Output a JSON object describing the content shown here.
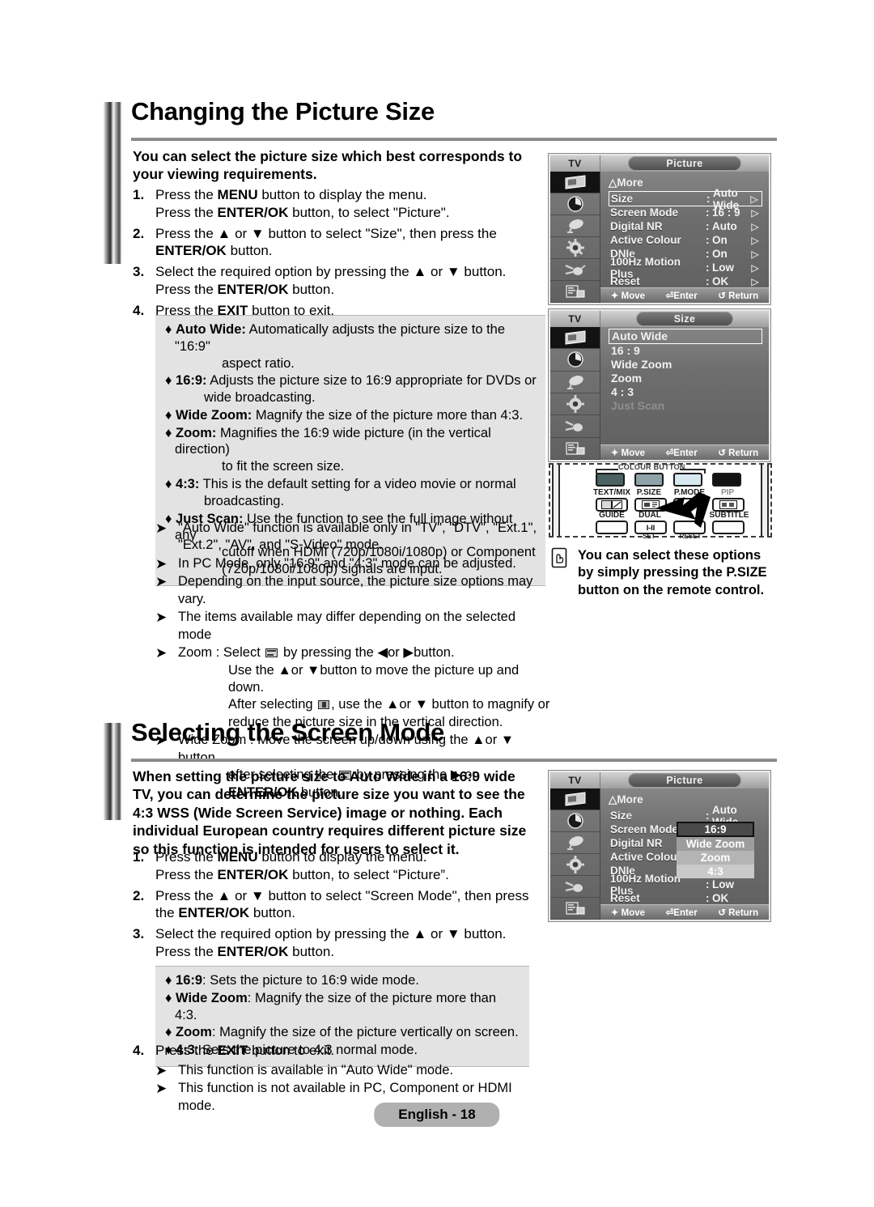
{
  "section1": {
    "title": "Changing the Picture Size",
    "intro": "You can select the picture size which best corresponds to your viewing requirements.",
    "steps": [
      {
        "num": "1.",
        "line1_a": "Press the ",
        "line1_b": "MENU",
        "line1_c": " button to display the menu.",
        "line2_a": "Press the ",
        "line2_b": "ENTER/OK",
        "line2_c": " button, to select \"Picture\"."
      },
      {
        "num": "2.",
        "line1_a": "Press the ▲ or ▼ button to select \"Size\", then press the ",
        "line1_b": "ENTER/OK",
        "line1_c": " button."
      },
      {
        "num": "3.",
        "line1_a": "Select the required option by pressing the ▲ or ▼ button.",
        "line2_a": "Press the ",
        "line2_b": "ENTER/OK",
        "line2_c": " button."
      },
      {
        "num": "4.",
        "line1_a": "Press the ",
        "line1_b": "EXIT",
        "line1_c": " button to exit."
      }
    ],
    "options": [
      {
        "label": "Auto Wide:",
        "text": " Automatically adjusts the picture size to the \"16:9\"",
        "cont": "aspect ratio."
      },
      {
        "label": "16:9:",
        "text": " Adjusts the picture size to 16:9 appropriate for DVDs or",
        "cont2": "wide broadcasting."
      },
      {
        "label": "Wide Zoom:",
        "text": " Magnify the size of the picture more than 4:3."
      },
      {
        "label": "Zoom:",
        "text": " Magnifies the 16:9 wide picture (in the vertical direction)",
        "cont": "to fit the screen size."
      },
      {
        "label": "4:3:",
        "text": " This is the default setting for a video movie or normal",
        "cont2": "broadcasting."
      },
      {
        "label": "Just Scan:",
        "text": " Use the function to see the full image without any",
        "cont": "cutoff when HDMI (720p/1080i/1080p) or Component",
        "cont_b": "(720p/1080i/1080p) signals are input."
      }
    ],
    "notes": [
      {
        "line1": "\"Auto Wide\" function is available only in \"TV\", \"DTV\",  \"Ext.1\",",
        "line2": "\"Ext.2\", \"AV\", and \"S-Video\" mode."
      },
      {
        "line1": "In PC Mode, only \"16:9\" and \"4:3\" mode can be adjusted."
      },
      {
        "line1": "Depending on the input source, the picture size options may vary."
      },
      {
        "line1": "The items available may differ depending on the selected mode"
      },
      {
        "line1_pre": "Zoom : Select ",
        "line1_post": " by pressing the ◀or ▶button.",
        "ind1": "Use the ▲or ▼button to move the picture up and down.",
        "ind2_pre": "After selecting ",
        "ind2_post": ", use the ▲or ▼ button to magnify or",
        "ind3": "reduce the picture size in the vertical direction."
      },
      {
        "line1": "Wide Zoom : Move the screen up/down using the ▲or ▼ button",
        "ind1_pre": "after selecting the ",
        "ind1_post": " by pressing the ▶ or",
        "ind2_bold": "ENTER/OK",
        "ind2_post": " button."
      }
    ]
  },
  "section2": {
    "title": "Selecting the Screen Mode",
    "intro": "When setting the picture size to Auto Wide in a 16:9 wide TV, you can determine the picture size you want to see the 4:3 WSS (Wide Screen Service) image or nothing. Each individual European country requires different picture size so this function is intended for users to select it.",
    "steps": [
      {
        "num": "1.",
        "line1_a": "Press the ",
        "line1_b": "MENU",
        "line1_c": " button to display the menu.",
        "line2_a": "Press the ",
        "line2_b": "ENTER/OK",
        "line2_c": " button, to select “Picture”."
      },
      {
        "num": "2.",
        "line1_a": "Press the ▲ or ▼ button to select \"Screen Mode\", then press",
        "line2_a": "the ",
        "line2_b": "ENTER/OK",
        "line2_c": " button."
      },
      {
        "num": "3.",
        "line1_a": "Select the required option by pressing the ▲ or ▼ button.",
        "line2_a": "Press the ",
        "line2_b": "ENTER/OK",
        "line2_c": " button."
      }
    ],
    "options": [
      {
        "label": "16:9",
        "text": ": Sets the picture to 16:9 wide mode."
      },
      {
        "label": "Wide Zoom",
        "text": ": Magnify the size of the picture more than 4:3."
      },
      {
        "label": "Zoom",
        "text": ": Magnify the size of the picture vertically on screen."
      },
      {
        "label": "4:3",
        "text": ": Sets the picture to 4:3 normal mode."
      }
    ],
    "step4": {
      "num": "4.",
      "line1_a": "Press the ",
      "line1_b": "EXIT",
      "line1_c": " button to exit."
    },
    "notes": [
      {
        "line1": "This function is available in \"Auto Wide\" mode."
      },
      {
        "line1": "This function is not available in PC, Component or HDMI mode."
      }
    ]
  },
  "osd_picture_top": {
    "source": "TV",
    "title": "Picture",
    "more": "More",
    "rows": [
      {
        "label": "Size",
        "value": "Auto Wide",
        "highlight": true
      },
      {
        "label": "Screen Mode",
        "value": "16 : 9"
      },
      {
        "label": "Digital NR",
        "value": "Auto"
      },
      {
        "label": "Active Colour",
        "value": "On"
      },
      {
        "label": "DNIe",
        "value": "On"
      },
      {
        "label": "100Hz Motion Plus",
        "value": "Low"
      },
      {
        "label": "Reset",
        "value": "OK"
      }
    ],
    "footer": {
      "move": "Move",
      "enter": "Enter",
      "return": "Return"
    }
  },
  "osd_size": {
    "source": "TV",
    "title": "Size",
    "items": [
      {
        "label": "Auto Wide",
        "highlight": true
      },
      {
        "label": "16 : 9"
      },
      {
        "label": "Wide Zoom"
      },
      {
        "label": "Zoom"
      },
      {
        "label": "4 : 3"
      },
      {
        "label": "Just Scan",
        "dim": true
      }
    ],
    "footer": {
      "move": "Move",
      "enter": "Enter",
      "return": "Return"
    }
  },
  "osd_picture_bottom": {
    "source": "TV",
    "title": "Picture",
    "more": "More",
    "rows": [
      {
        "label": "Size",
        "value": "Auto Wide"
      },
      {
        "label": "Screen Mode",
        "value": ""
      },
      {
        "label": "Digital NR",
        "value": ""
      },
      {
        "label": "Active Colour",
        "value": ""
      },
      {
        "label": "DNIe",
        "value": ""
      },
      {
        "label": "100Hz Motion Plus",
        "value": "Low"
      },
      {
        "label": "Reset",
        "value": "OK"
      }
    ],
    "dropdown": {
      "current": "16:9",
      "options": [
        "Wide Zoom",
        "Zoom",
        "4:3"
      ]
    },
    "footer": {
      "move": "Move",
      "enter": "Enter",
      "return": "Return"
    }
  },
  "remote": {
    "colour_button_label": "COLOUR BUTTON",
    "colours": [
      "#4c6161",
      "#8fa3a8",
      "#d9e9f2",
      "#121212"
    ],
    "row1": [
      "TEXT/MIX",
      "P.SIZE",
      "P.MODE",
      "PIP"
    ],
    "row2": [
      "GUIDE",
      "DUAL",
      "",
      "SUBTITLE"
    ],
    "dual_btn": "I-II",
    "bottom": [
      "SET",
      "RESET"
    ]
  },
  "tip": {
    "line1": "You can select these options",
    "line2_a": "by simply pressing the ",
    "line2_b": "P.SIZE",
    "line3": "button on the remote control."
  },
  "footer": {
    "label": "English - 18"
  }
}
